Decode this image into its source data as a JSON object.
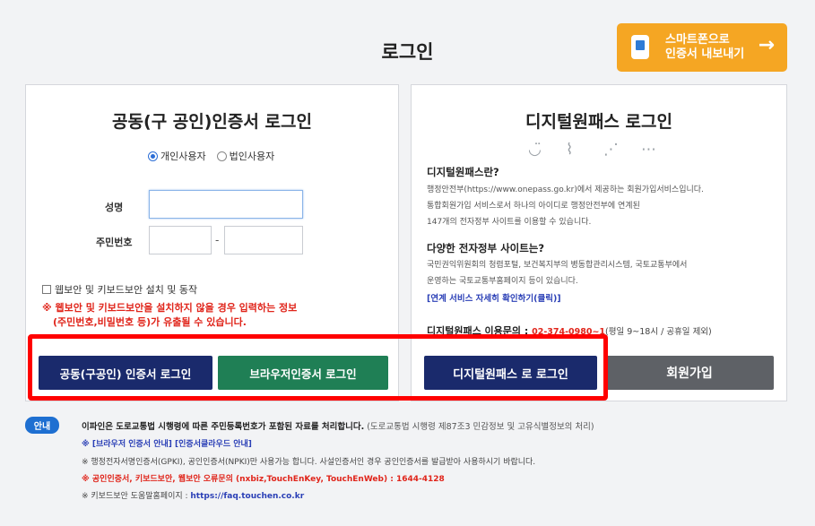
{
  "page_title": "로그인",
  "export_button": {
    "line1": "스마트폰으로",
    "line2": "인증서 내보내기",
    "arrow": "→"
  },
  "left_panel": {
    "title": "공동(구 공인)인증서 로그인",
    "radio": {
      "personal": "개인사용자",
      "corporate": "법인사용자",
      "selected": "personal"
    },
    "name_label": "성명",
    "rrn_label": "주민번호",
    "rrn_sep": "-",
    "security_checkbox": "웹보안 및 키보드보안 설치 및 동작",
    "warning_line1": "※ 웹보안 및 키보드보안을 설치하지 않을 경우 입력하는 정보",
    "warning_line2": "(주민번호,비밀번호 등)가 유출될 수 있습니다.",
    "btn_cert_login": "공동(구공인) 인증서 로그인",
    "btn_browser_login": "브라우저인증서 로그인"
  },
  "right_panel": {
    "title": "디지털원패스 로그인",
    "what_heading": "디지털원패스란?",
    "what_text": [
      "행정안전부(https://www.onepass.go.kr)에서 제공하는 회원가입서비스입니다.",
      "통합회원가입 서비스로서 하나의 아이디로 행정안전부에 연계된",
      "147개의 전자정부 사이트를 이용할 수 있습니다."
    ],
    "sites_heading": "다양한 전자정부 사이트는?",
    "sites_text": [
      "국민권익위원회의 청렴포털, 보건복지부의 병동합관리시스템, 국토교통부에서",
      "운영하는 국토교통부홈페이지 등이 있습니다."
    ],
    "sites_link": "[연계 서비스 자세히 확인하기(클릭)]",
    "contact_label": "디지털원패스 이용문의 : ",
    "contact_number": "02-374-0980~1",
    "contact_hours": "(평일 9~18시 / 공휴일 제외)",
    "btn_onepass_login": "디지털원패스 로 로그인",
    "btn_signup": "회원가입"
  },
  "notice": {
    "badge": "안내",
    "line1_bold": "이파인은 도로교통법 시행령에 따른 주민등록번호가 포함된 자료를 처리합니다.",
    "line1_rest": " (도로교통법 시행령 제87조3 민감정보 및 고유식별정보의 처리)",
    "line2": "※ [브라우저 인증서 안내] [인증서클라우드 안내]",
    "line3": "※ 행정전자서명인증서(GPKI), 공인인증서(NPKI)만 사용가능 합니다. 사설인증서인 경우 공인인증서를 발급받아 사용하시기 바랍니다.",
    "line4": "※ 공인인증서, 키보드보안, 웹보안 오류문의 (nxbiz,TouchEnKey, TouchEnWeb) : 1644-4128",
    "line5_prefix": "※ 키보드보안 도움말홈페이지 : ",
    "line5_link": "https://faq.touchen.co.kr"
  }
}
